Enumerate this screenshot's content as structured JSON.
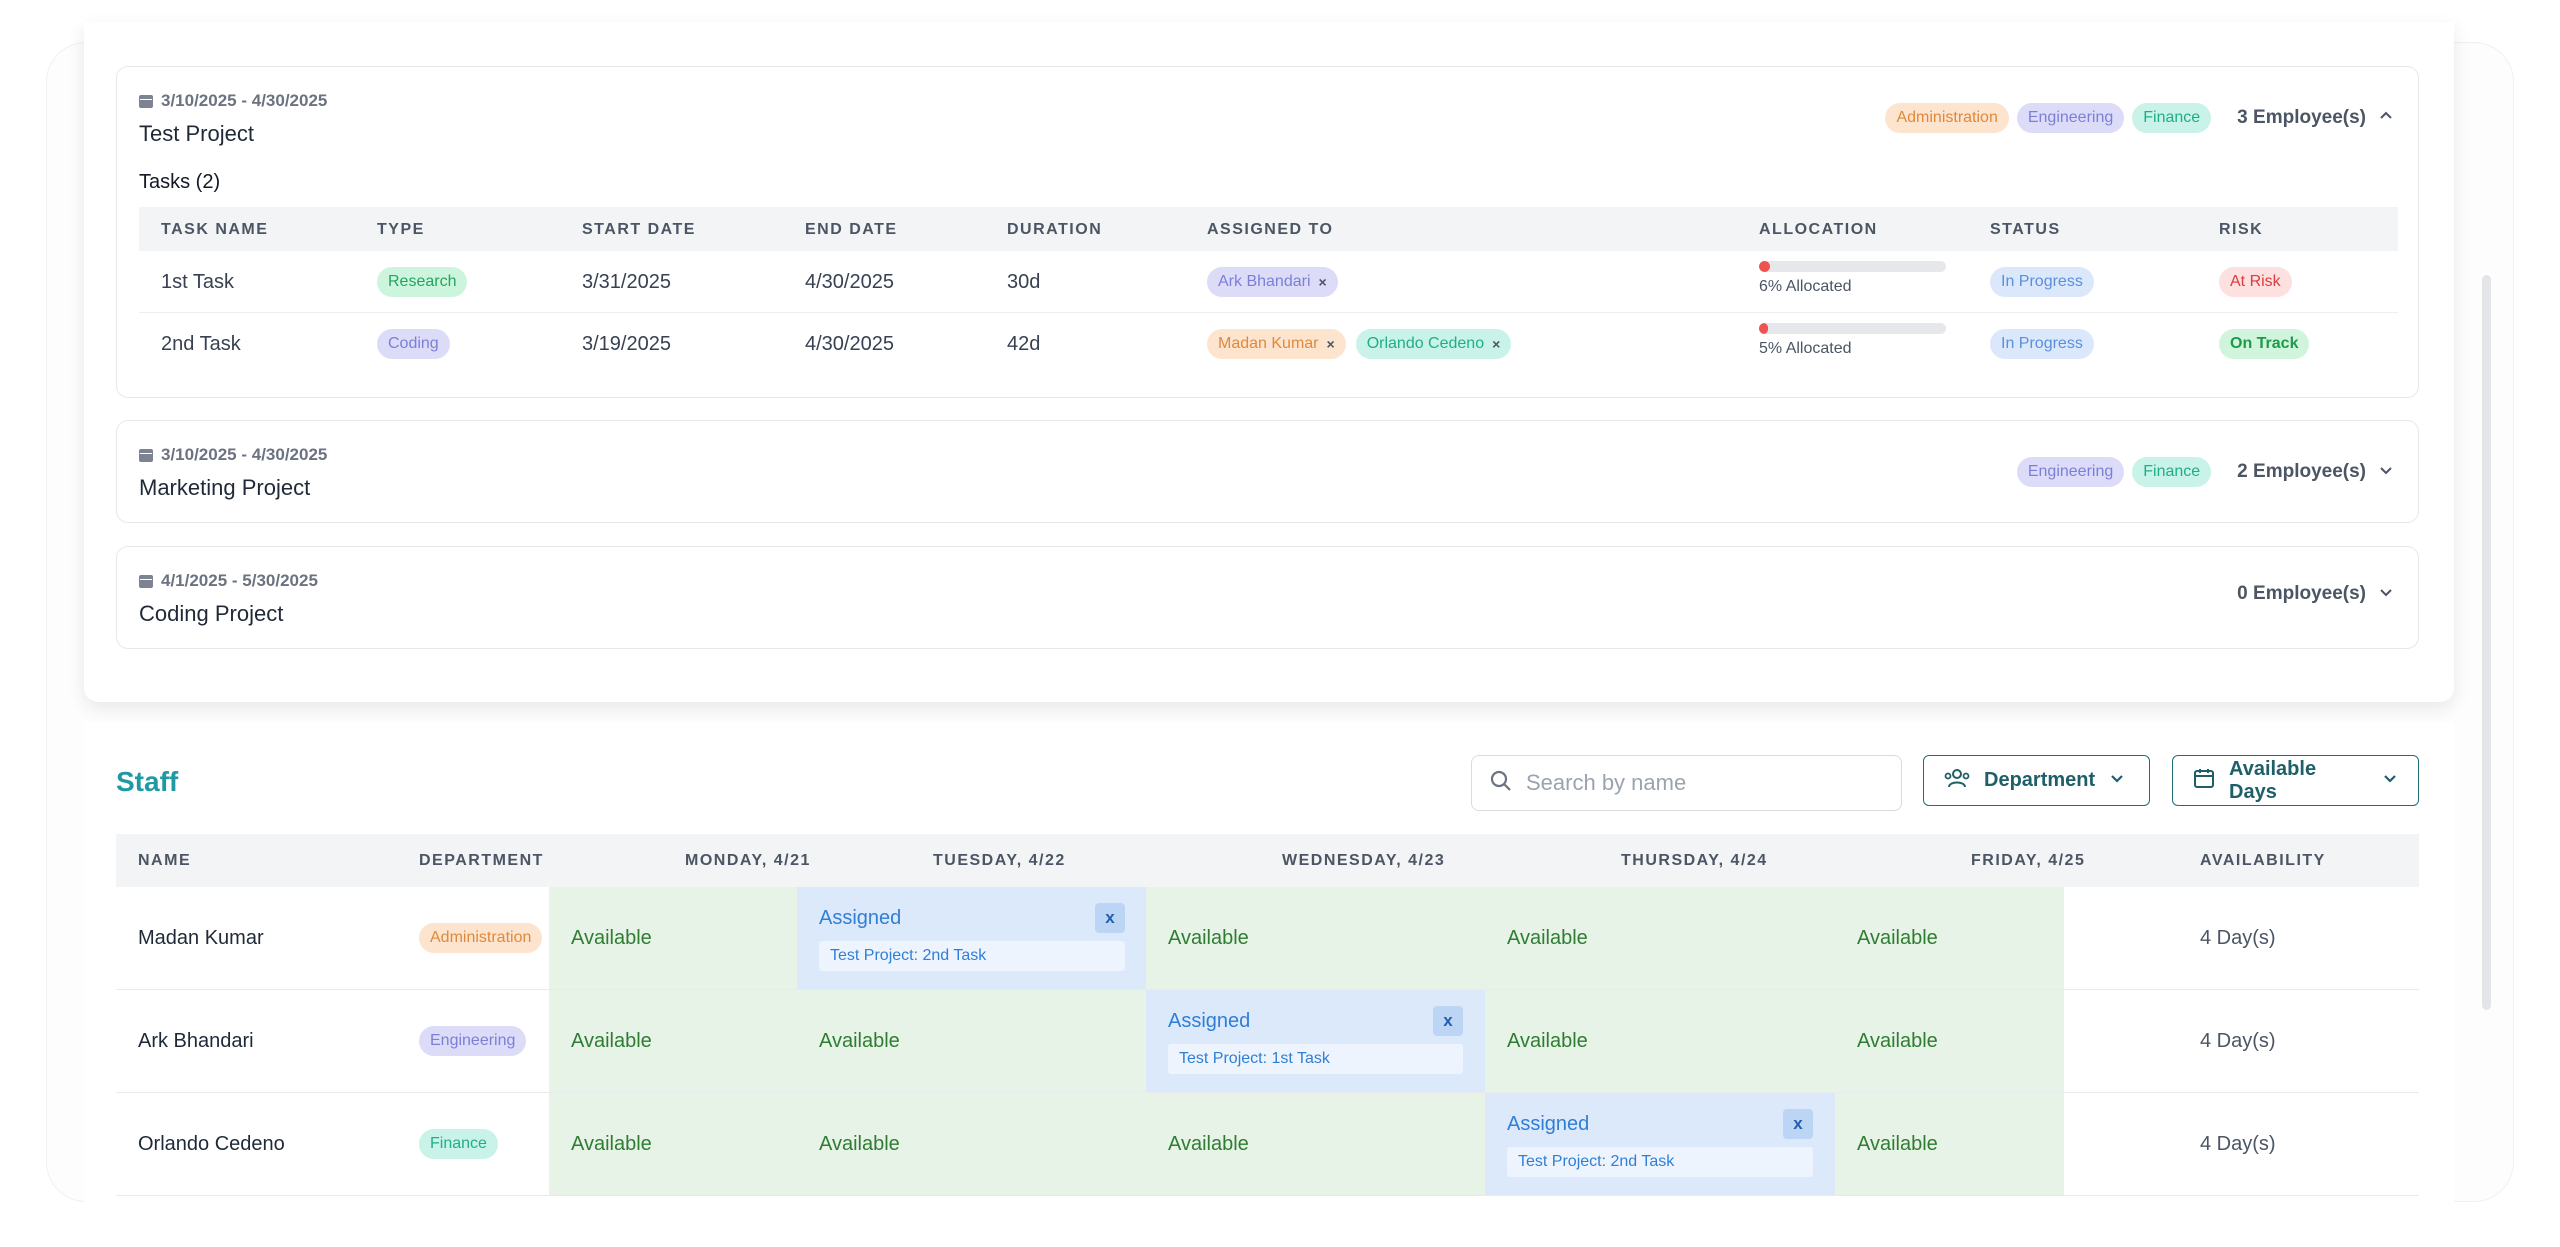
{
  "projects": [
    {
      "date_range": "3/10/2025 - 4/30/2025",
      "title": "Test Project",
      "departments": [
        "Administration",
        "Engineering",
        "Finance"
      ],
      "employees": "3 Employee(s)",
      "chevron": "^",
      "tasks_heading": "Tasks (2)",
      "task_columns": [
        "TASK NAME",
        "TYPE",
        "START DATE",
        "END DATE",
        "DURATION",
        "ASSIGNED TO",
        "ALLOCATION",
        "STATUS",
        "RISK"
      ],
      "tasks": [
        {
          "name": "1st Task",
          "type": "Research",
          "start": "3/31/2025",
          "end": "4/30/2025",
          "duration": "30d",
          "assigned": [
            "Ark Bhandari"
          ],
          "allocation_text": "6% Allocated",
          "allocation_pct": 6,
          "status": "In Progress",
          "risk": "At Risk"
        },
        {
          "name": "2nd Task",
          "type": "Coding",
          "start": "3/19/2025",
          "end": "4/30/2025",
          "duration": "42d",
          "assigned": [
            "Madan Kumar",
            "Orlando Cedeno"
          ],
          "allocation_text": "5% Allocated",
          "allocation_pct": 5,
          "status": "In Progress",
          "risk": "On Track"
        }
      ]
    },
    {
      "date_range": "3/10/2025 - 4/30/2025",
      "title": "Marketing Project",
      "departments": [
        "Engineering",
        "Finance"
      ],
      "employees": "2 Employee(s)"
    },
    {
      "date_range": "4/1/2025 - 5/30/2025",
      "title": "Coding Project",
      "departments": [],
      "employees": "0 Employee(s)"
    }
  ],
  "remove_glyph": "×",
  "staff": {
    "title": "Staff",
    "search_placeholder": "Search by name",
    "department_button": "Department",
    "days_button": "Available Days",
    "columns": [
      "NAME",
      "DEPARTMENT",
      "MONDAY, 4/21",
      "TUESDAY, 4/22",
      "WEDNESDAY, 4/23",
      "THURSDAY, 4/24",
      "FRIDAY, 4/25",
      "AVAILABILITY"
    ],
    "rows": [
      {
        "name": "Madan Kumar",
        "department": "Administration",
        "days": [
          "Available",
          "Assigned",
          "Available",
          "Available",
          "Available"
        ],
        "assigned_task": "Test Project: 2nd Task",
        "availability": "4 Day(s)"
      },
      {
        "name": "Ark Bhandari",
        "department": "Engineering",
        "days": [
          "Available",
          "Available",
          "Assigned",
          "Available",
          "Available"
        ],
        "assigned_task": "Test Project: 1st Task",
        "availability": "4 Day(s)"
      },
      {
        "name": "Orlando Cedeno",
        "department": "Finance",
        "days": [
          "Available",
          "Available",
          "Available",
          "Assigned",
          "Available"
        ],
        "assigned_task": "Test Project: 2nd Task",
        "availability": "4 Day(s)"
      }
    ],
    "unassign_label": "x"
  },
  "colors": {
    "accent": "#1f9aa5",
    "available_bg": "#e8f3e8",
    "assigned_bg": "#dce9fb",
    "alloc_fill": "#ef5350"
  }
}
